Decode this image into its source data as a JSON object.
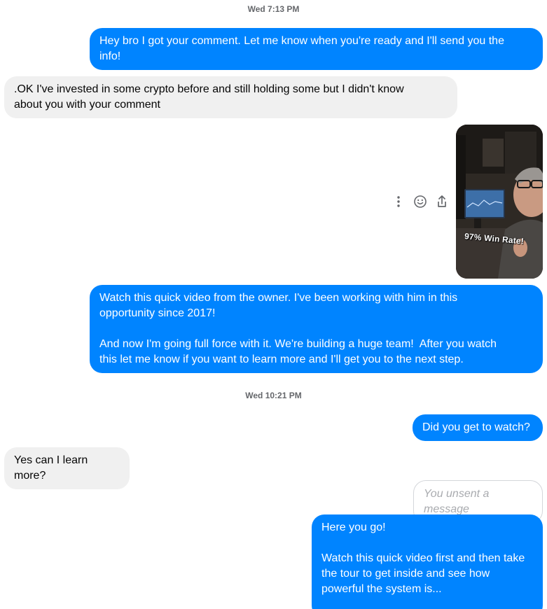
{
  "timestamps": [
    "Wed 7:13 PM",
    "Wed 10:21 PM"
  ],
  "messages": [
    {
      "direction": "outgoing",
      "text": "Hey bro I got your comment. Let me know when you're ready and I'll send you the\ninfo!"
    },
    {
      "direction": "incoming",
      "text": ".OK I've invested in some crypto before and still holding some but I didn't know\nabout you with your comment"
    },
    {
      "direction": "outgoing",
      "type": "video",
      "caption": "97% Win Rate!"
    },
    {
      "direction": "outgoing",
      "text": "Watch this quick video from the owner. I've been working with him in this\nopportunity since 2017!\n\nAnd now I'm going full force with it. We're building a huge team!  After you watch\nthis let me know if you want to learn more and I'll get you to the next step."
    },
    {
      "direction": "outgoing",
      "text": "Did you get to watch?"
    },
    {
      "direction": "incoming",
      "text": "Yes can I learn more?"
    },
    {
      "direction": "outgoing",
      "type": "unsent",
      "text": "You unsent a message"
    },
    {
      "direction": "outgoing",
      "text": "Here you go!\n\nWatch this quick video first and then take\nthe tour to get inside and see how\npowerful the system is..."
    }
  ],
  "message_actions": {
    "more_icon": "more-vertical-icon",
    "react_icon": "smiley-icon",
    "share_icon": "share-icon"
  },
  "colors": {
    "outgoing_bubble": "#0084ff",
    "incoming_bubble": "#f0f0f0",
    "timestamp_text": "#65676b",
    "unsent_text": "#a9abaf"
  }
}
